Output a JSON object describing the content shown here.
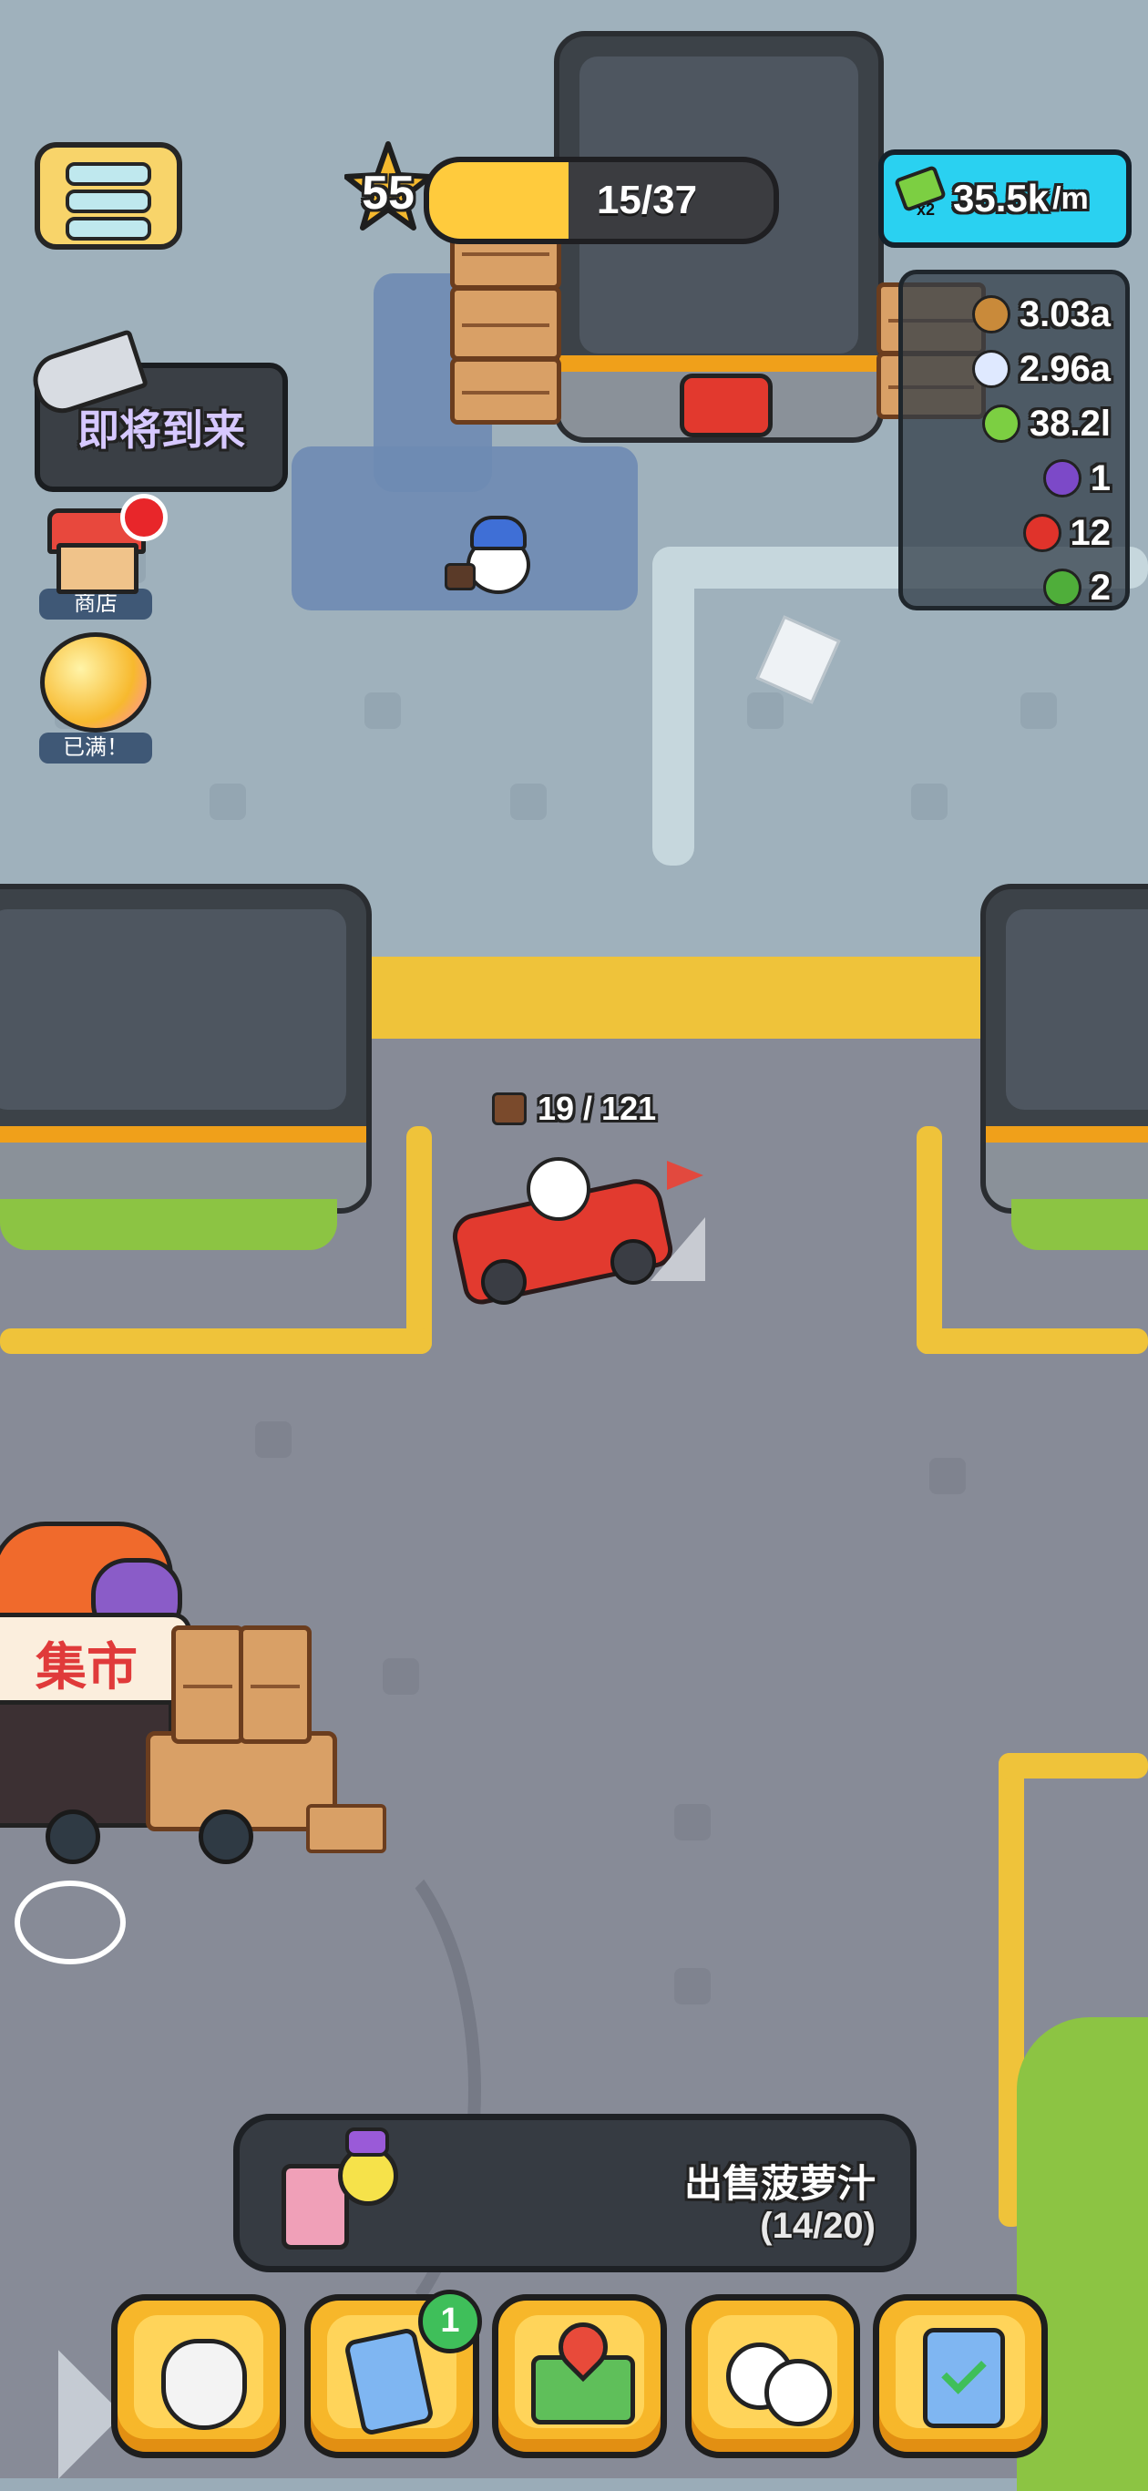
{
  "hud": {
    "level": "55",
    "xp_text": "15/37",
    "xp_progress": 0.405,
    "income_rate": "35.5k",
    "income_unit": "/m",
    "income_multiplier": "x2",
    "menu_icon": "menu-icon"
  },
  "resources": [
    {
      "icon": "cookie-icon",
      "color": "#c98a3a",
      "value": "3.03a"
    },
    {
      "icon": "diamond-icon",
      "color": "#dfe9ff",
      "value": "2.96a"
    },
    {
      "icon": "cash-icon",
      "color": "#7ccf42",
      "value": "38.2l"
    },
    {
      "icon": "grape-icon",
      "color": "#7c49c8",
      "value": "1"
    },
    {
      "icon": "apple-icon",
      "color": "#e0332b",
      "value": "12"
    },
    {
      "icon": "watermelon-icon",
      "color": "#4fae3a",
      "value": "2"
    }
  ],
  "sidebar": {
    "coming_soon": "即将到来",
    "shop_label": "商店",
    "piggy_label": "已满！"
  },
  "world": {
    "cargo_count": "19 / 121",
    "market_sign": "集市"
  },
  "mission": {
    "title": "出售菠萝汁",
    "progress": "(14/20)"
  },
  "bottom_bar": {
    "buttons": [
      {
        "name": "character-button",
        "icon": "hockey-mask-icon"
      },
      {
        "name": "cards-button",
        "icon": "cards-icon",
        "badge": "1"
      },
      {
        "name": "map-button",
        "icon": "map-pin-icon"
      },
      {
        "name": "staff-button",
        "icon": "workers-icon"
      },
      {
        "name": "tasks-button",
        "icon": "clipboard-check-icon"
      }
    ]
  },
  "colors": {
    "accent_yellow": "#f7b72a",
    "rate_bg": "#2ad1f1",
    "road": "#878b97",
    "sidewalk": "#9fb1bc"
  }
}
